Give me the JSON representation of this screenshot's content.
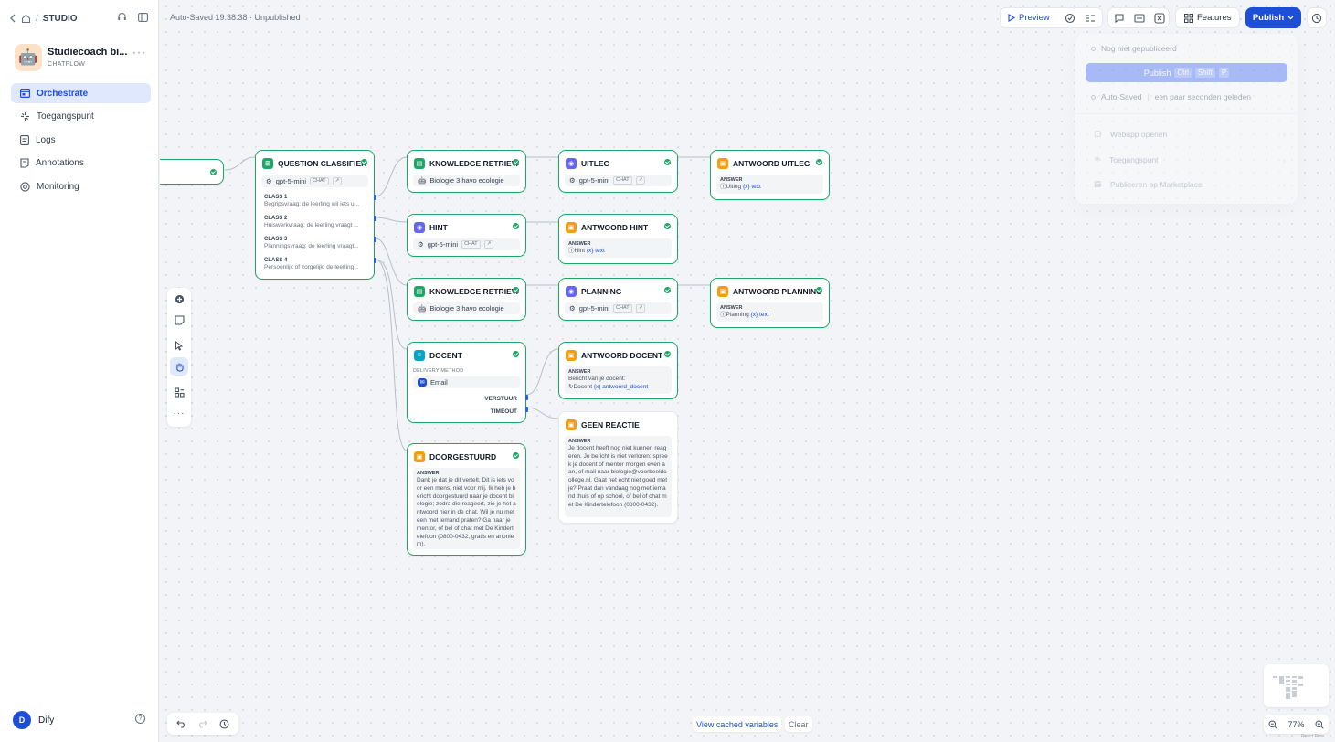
{
  "breadcrumb": {
    "section": "STUDIO"
  },
  "app": {
    "name": "Studiecoach bi...",
    "type": "CHATFLOW",
    "icon": "robot-emoji",
    "more": "···"
  },
  "nav": {
    "items": [
      {
        "label": "Orchestrate",
        "icon": "orchestrate-icon",
        "active": true
      },
      {
        "label": "Toegangspunt",
        "icon": "access-point-icon"
      },
      {
        "label": "Logs",
        "icon": "logs-icon"
      },
      {
        "label": "Annotations",
        "icon": "annotations-icon"
      },
      {
        "label": "Monitoring",
        "icon": "monitoring-icon"
      }
    ]
  },
  "user": {
    "initial": "D",
    "name": "Dify"
  },
  "status": {
    "autosaved": "Auto-Saved 19:38:38 · Unpublished"
  },
  "header": {
    "preview": "Preview",
    "features": "Features",
    "publish": "Publish"
  },
  "publish_menu": {
    "not_published": "Nog niet gepubliceerd",
    "publish_label": "Publish",
    "shortcut": [
      "Ctrl",
      "Shift",
      "P"
    ],
    "autosaved_label": "Auto-Saved",
    "autosaved_when": "een paar seconden geleden",
    "items": [
      "Webapp openen",
      "Toegangspunt",
      "Publiceren op Marketplace"
    ]
  },
  "nodes": {
    "start": {
      "title": "r"
    },
    "classifier": {
      "title": "QUESTION CLASSIFIER",
      "model": "gpt-5-mini",
      "mode": "CHAT",
      "classes": [
        {
          "name": "CLASS 1",
          "desc": "Begripsvraag: de leerling wil iets u..."
        },
        {
          "name": "CLASS 2",
          "desc": "Huiswerkvraag: de leerling vraagt ..."
        },
        {
          "name": "CLASS 3",
          "desc": "Planningsvraag: de leerling vraagt..."
        },
        {
          "name": "CLASS 4",
          "desc": "Persoonlijk of zorgelijk: de leerling..."
        }
      ]
    },
    "kr1": {
      "title": "KNOWLEDGE RETRIEVAL",
      "dataset": "Biologie 3 havo ecologie"
    },
    "kr2": {
      "title": "KNOWLEDGE RETRIEVA...",
      "dataset": "Biologie 3 havo ecologie"
    },
    "uitleg": {
      "title": "UITLEG",
      "model": "gpt-5-mini",
      "mode": "CHAT"
    },
    "hint": {
      "title": "HINT",
      "model": "gpt-5-mini",
      "mode": "CHAT"
    },
    "planning": {
      "title": "PLANNING",
      "model": "gpt-5-mini",
      "mode": "CHAT"
    },
    "a_uitleg": {
      "title": "ANTWOORD UITLEG",
      "label": "ANSWER",
      "source": "Uitleg",
      "var": "{x} text"
    },
    "a_hint": {
      "title": "ANTWOORD HINT",
      "label": "ANSWER",
      "source": "Hint",
      "var": "{x} text"
    },
    "a_planning": {
      "title": "ANTWOORD PLANNING",
      "label": "ANSWER",
      "source": "Planning",
      "var": "{x} text"
    },
    "docent": {
      "title": "DOCENT",
      "delivery_label": "DELIVERY METHOD",
      "delivery": "Email",
      "out1": "VERSTUUR",
      "out2": "TIMEOUT"
    },
    "a_docent": {
      "title": "ANTWOORD DOCENT",
      "label": "ANSWER",
      "text": "Bericht van je docent:",
      "source": "Docent",
      "var": "{x} antwoord_docent"
    },
    "geen": {
      "title": "GEEN REACTIE",
      "label": "ANSWER",
      "text": "Je docent heeft nog niet kunnen reageren. Je bericht is niet verloren: spreek je docent of mentor morgen even aan, of mail naar biologie@voorbeeldcollege.nl. Gaat het echt niet goed met je? Praat dan vandaag nog met iemand thuis of op school, of bel of chat met De Kindertelefoon (0800-0432)."
    },
    "doorgestuurd": {
      "title": "DOORGESTUURD",
      "label": "ANSWER",
      "text": "Dank je dat je dit vertelt. Dit is iets voor een mens, niet voor mij. Ik heb je bericht doorgestuurd naar je docent biologie; zodra die reageert, zie je het antwoord hier in de chat. Wil je nu meteen met iemand praten? Ga naar je mentor, of bel of chat met De Kindertelefoon (0800-0432, gratis en anoniem)."
    }
  },
  "bottom": {
    "cached": "View cached variables",
    "clear": "Clear",
    "zoom": "77%",
    "attribution": "React Flow"
  },
  "colors": {
    "accent": "#1d4ed8",
    "success": "#1fa565",
    "llm": "#6366f1",
    "answer": "#f59e0b",
    "human": "#06a5c8"
  }
}
